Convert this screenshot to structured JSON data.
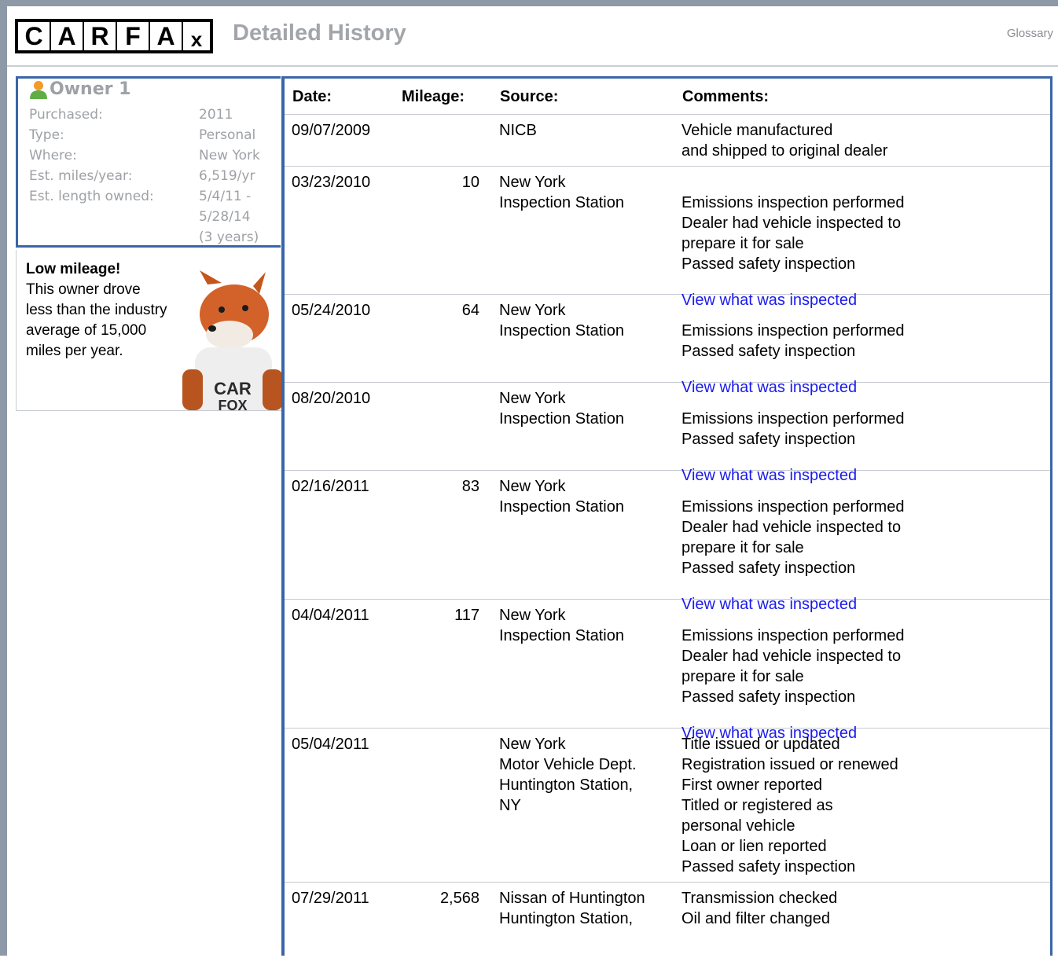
{
  "header": {
    "logo_letters": [
      "C",
      "A",
      "R",
      "F",
      "A",
      "x"
    ],
    "title": "Detailed History",
    "glossary_link": "Glossary"
  },
  "owner": {
    "title": "Owner 1",
    "icon": "person-icon",
    "fields": [
      {
        "label": "Purchased:",
        "value": "2011"
      },
      {
        "label": "Type:",
        "value": "Personal"
      },
      {
        "label": "Where:",
        "value": "New York"
      },
      {
        "label": "Est. miles/year:",
        "value": "6,519/yr"
      },
      {
        "label": "Est. length owned:",
        "value": "5/4/11 -\n5/28/14\n(3 years)"
      }
    ]
  },
  "tip": {
    "heading": "Low mileage!",
    "body": "This owner drove less than the industry average of 15,000 miles per year.",
    "shirt_text_1": "CAR",
    "shirt_text_2": "FOX"
  },
  "table": {
    "headers": {
      "date": "Date:",
      "mileage": "Mileage:",
      "source": "Source:",
      "comments": "Comments:"
    },
    "rows": [
      {
        "date": "09/07/2009",
        "mileage": "",
        "source": "NICB",
        "comments": "Vehicle manufactured\nand shipped to original dealer",
        "link": ""
      },
      {
        "date": "03/23/2010",
        "mileage": "10",
        "source": "New York\nInspection Station",
        "comments": "Emissions inspection performed\nDealer had vehicle inspected to\nprepare it for sale\nPassed safety inspection",
        "link": "View what was inspected"
      },
      {
        "date": "05/24/2010",
        "mileage": "64",
        "source": "New York\nInspection Station",
        "comments": "Emissions inspection performed\nPassed safety inspection",
        "link": "View what was inspected"
      },
      {
        "date": "08/20/2010",
        "mileage": "",
        "source": "New York\nInspection Station",
        "comments": "Emissions inspection performed\nPassed safety inspection",
        "link": "View what was inspected"
      },
      {
        "date": "02/16/2011",
        "mileage": "83",
        "source": "New York\nInspection Station",
        "comments": "Emissions inspection performed\nDealer had vehicle inspected to\nprepare it for sale\nPassed safety inspection",
        "link": "View what was inspected"
      },
      {
        "date": "04/04/2011",
        "mileage": "117",
        "source": "New York\nInspection Station",
        "comments": "Emissions inspection performed\nDealer had vehicle inspected to\nprepare it for sale\nPassed safety inspection",
        "link": "View what was inspected"
      },
      {
        "date": "05/04/2011",
        "mileage": "",
        "source": "New York\nMotor Vehicle Dept.\nHuntington Station,\nNY",
        "comments": "Title issued or updated\nRegistration issued or renewed\nFirst owner reported\nTitled or registered as\npersonal vehicle\nLoan or lien reported\nPassed safety inspection",
        "link": ""
      },
      {
        "date": "07/29/2011",
        "mileage": "2,568",
        "source": "Nissan of Huntington\nHuntington Station,",
        "comments": "Transmission checked\nOil and filter changed",
        "link": ""
      }
    ]
  },
  "colors": {
    "accent": "#3a66a8",
    "link": "#1a1aee",
    "muted": "#9ea1a5"
  }
}
